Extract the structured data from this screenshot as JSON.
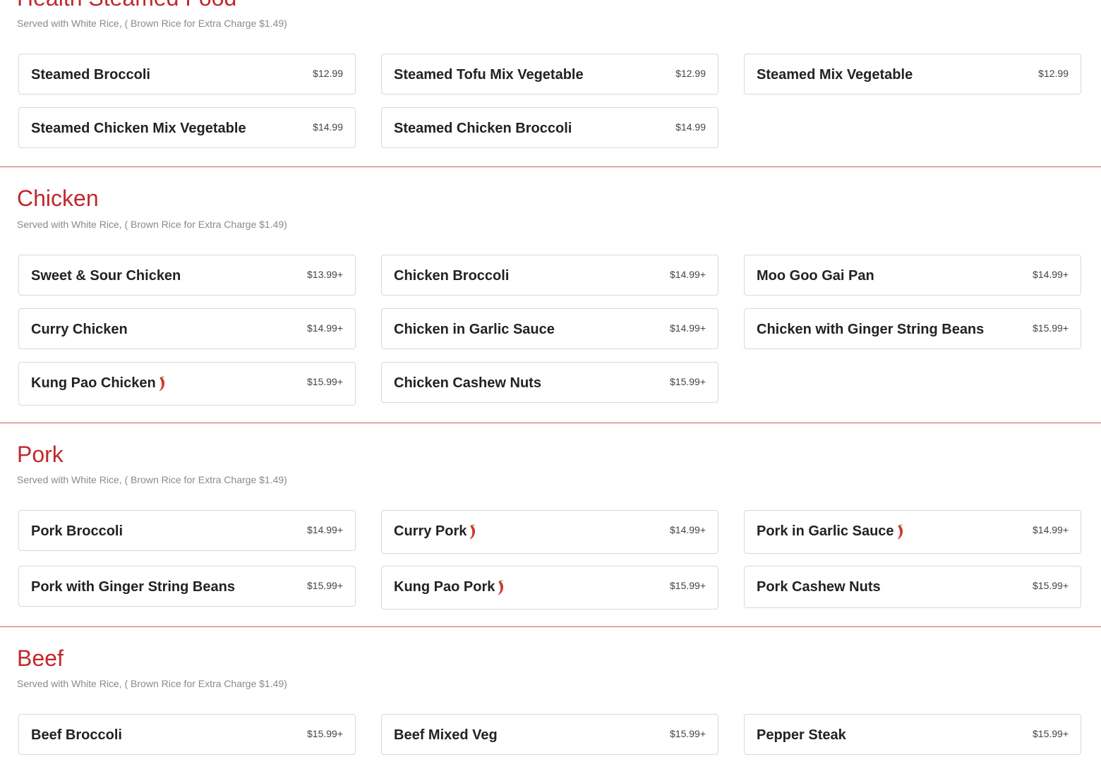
{
  "colors": {
    "accent": "#c0282d",
    "note": "#8a8a8a",
    "card_border": "#d9d9d9",
    "text": "#222222"
  },
  "sections": [
    {
      "title": "Health Steamed Food",
      "note": "Served with White Rice, ( Brown Rice for Extra Charge $1.49)",
      "items": [
        {
          "name": "Steamed Broccoli",
          "price": "$12.99",
          "spicy": false
        },
        {
          "name": "Steamed Tofu Mix Vegetable",
          "price": "$12.99",
          "spicy": false
        },
        {
          "name": "Steamed Mix Vegetable",
          "price": "$12.99",
          "spicy": false
        },
        {
          "name": "Steamed Chicken Mix Vegetable",
          "price": "$14.99",
          "spicy": false
        },
        {
          "name": "Steamed Chicken Broccoli",
          "price": "$14.99",
          "spicy": false
        }
      ]
    },
    {
      "title": "Chicken",
      "note": "Served with White Rice, ( Brown Rice for Extra Charge $1.49)",
      "items": [
        {
          "name": "Sweet & Sour Chicken",
          "price": "$13.99+",
          "spicy": false
        },
        {
          "name": "Chicken Broccoli",
          "price": "$14.99+",
          "spicy": false
        },
        {
          "name": "Moo Goo Gai Pan",
          "price": "$14.99+",
          "spicy": false
        },
        {
          "name": "Curry Chicken",
          "price": "$14.99+",
          "spicy": false
        },
        {
          "name": "Chicken in Garlic Sauce",
          "price": "$14.99+",
          "spicy": false
        },
        {
          "name": "Chicken with Ginger String Beans",
          "price": "$15.99+",
          "spicy": false
        },
        {
          "name": "Kung Pao Chicken",
          "price": "$15.99+",
          "spicy": true,
          "icon": "chili-pepper-icon"
        },
        {
          "name": "Chicken Cashew Nuts",
          "price": "$15.99+",
          "spicy": false
        }
      ]
    },
    {
      "title": "Pork",
      "note": "Served with White Rice, ( Brown Rice for Extra Charge $1.49)",
      "items": [
        {
          "name": "Pork Broccoli",
          "price": "$14.99+",
          "spicy": false
        },
        {
          "name": "Curry Pork",
          "price": "$14.99+",
          "spicy": true,
          "icon": "chili-pepper-icon"
        },
        {
          "name": "Pork in Garlic Sauce",
          "price": "$14.99+",
          "spicy": true,
          "icon": "chili-pepper-icon"
        },
        {
          "name": "Pork with Ginger String Beans",
          "price": "$15.99+",
          "spicy": false
        },
        {
          "name": "Kung Pao Pork",
          "price": "$15.99+",
          "spicy": true,
          "icon": "chili-pepper-icon"
        },
        {
          "name": "Pork Cashew Nuts",
          "price": "$15.99+",
          "spicy": false
        }
      ]
    },
    {
      "title": "Beef",
      "note": "Served with White Rice, ( Brown Rice for Extra Charge $1.49)",
      "items": [
        {
          "name": "Beef Broccoli",
          "price": "$15.99+",
          "spicy": false
        },
        {
          "name": "Beef Mixed Veg",
          "price": "$15.99+",
          "spicy": false
        },
        {
          "name": "Pepper Steak",
          "price": "$15.99+",
          "spicy": false
        }
      ]
    }
  ]
}
